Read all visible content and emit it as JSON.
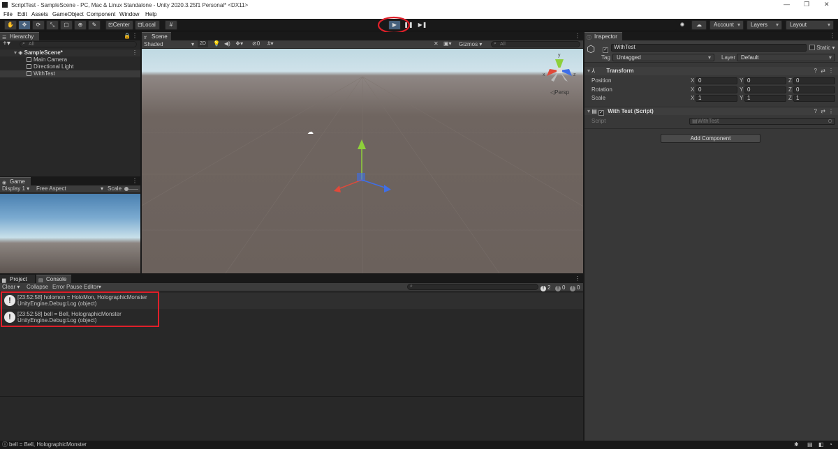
{
  "window": {
    "title": "ScriptTest - SampleScene - PC, Mac & Linux Standalone - Unity 2020.3.25f1 Personal* <DX11>"
  },
  "menu": [
    "File",
    "Edit",
    "Assets",
    "GameObject",
    "Component",
    "Window",
    "Help"
  ],
  "toolbar": {
    "center_label": "Center",
    "local_label": "Local",
    "account_label": "Account",
    "layers_label": "Layers",
    "layout_label": "Layout"
  },
  "hierarchy": {
    "tab": "Hierarchy",
    "search_placeholder": "All",
    "scene": "SampleScene*",
    "items": [
      "Main Camera",
      "Directional Light",
      "WithTest"
    ]
  },
  "scene": {
    "tab": "Scene",
    "shading": "Shaded",
    "mode_2d": "2D",
    "hidden_count": "0",
    "gizmos": "Gizmos",
    "search_placeholder": "All",
    "persp": "Persp",
    "axis_y": "y",
    "axis_x": "x",
    "axis_z": "z"
  },
  "game": {
    "tab": "Game",
    "display": "Display 1",
    "aspect": "Free Aspect",
    "scale": "Scale"
  },
  "inspector": {
    "tab": "Inspector",
    "object_name": "WithTest",
    "static_label": "Static",
    "tag_label": "Tag",
    "tag_value": "Untagged",
    "layer_label": "Layer",
    "layer_value": "Default",
    "transform_title": "Transform",
    "rows": [
      {
        "label": "Position",
        "x": "0",
        "y": "0",
        "z": "0"
      },
      {
        "label": "Rotation",
        "x": "0",
        "y": "0",
        "z": "0"
      },
      {
        "label": "Scale",
        "x": "1",
        "y": "1",
        "z": "1"
      }
    ],
    "axis_x": "X",
    "axis_y": "Y",
    "axis_z": "Z",
    "script_component_title": "With Test (Script)",
    "script_label": "Script",
    "script_value": "WithTest",
    "add_component": "Add Component"
  },
  "console": {
    "project_tab": "Project",
    "console_tab": "Console",
    "clear": "Clear",
    "collapse": "Collapse",
    "error_pause": "Error Pause",
    "editor": "Editor",
    "warn_count": "2",
    "info_count": "0",
    "error_count": "0",
    "entries": [
      {
        "line1": "[23:52:58] holomon = HoloMon, HolographicMonster",
        "line2": "UnityEngine.Debug:Log (object)"
      },
      {
        "line1": "[23:52:58] bell = Bell, HolographicMonster",
        "line2": "UnityEngine.Debug:Log (object)"
      }
    ]
  },
  "statusbar": {
    "message": "bell = Bell, HolographicMonster"
  },
  "colors": {
    "accent": "#46607c",
    "annotation_red": "#e0202a",
    "x_axis": "#e0493a",
    "y_axis": "#8ed03a",
    "z_axis": "#3f6fe8"
  }
}
